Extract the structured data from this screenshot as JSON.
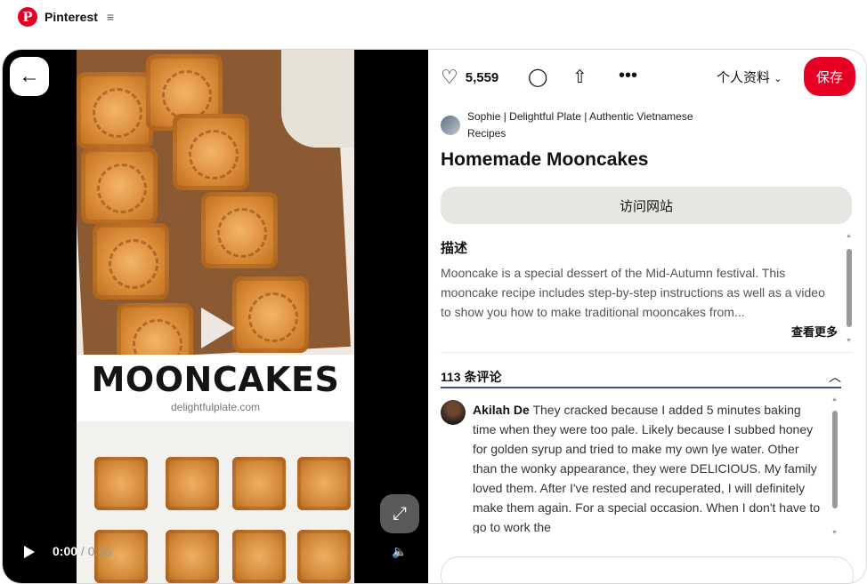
{
  "app": {
    "name": "Pinterest",
    "accent": "#e60023"
  },
  "media": {
    "banner_title": "MOONCAKES",
    "banner_sub": "delightfulplate.com",
    "time_current": "0:00",
    "time_total": "0:55",
    "progress": 0
  },
  "actions": {
    "like_count": "5,559",
    "profile_label": "个人资料",
    "save_label": "保存"
  },
  "pin": {
    "author": "Sophie | Delightful Plate | Authentic Vietnamese Recipes",
    "title": "Homemade Mooncakes",
    "visit_label": "访问网站",
    "desc_heading": "描述",
    "description": "Mooncake is a special dessert of the Mid-Autumn festival. This mooncake recipe includes step-by-step instructions as well as a video to show you how to make traditional mooncakes from...",
    "more_label": "查看更多"
  },
  "comments": {
    "heading": "113 条评论",
    "items": [
      {
        "author": "Akilah De",
        "text": "They cracked because I added 5 minutes baking time when they were too pale. Likely because I subbed honey for golden syrup and tried to make my own lye water. Other than the wonky appearance, they were DELICIOUS. My family loved them. After I've rested and recuperated, I will definitely make them again. For a special occasion. When I don't have to go to work the"
      }
    ]
  },
  "icons": [
    "pinterest-logo-icon",
    "menu-icon",
    "back-arrow-icon",
    "play-icon",
    "expand-icon",
    "volume-icon",
    "heart-icon",
    "comment-icon",
    "share-icon",
    "more-icon",
    "chevron-down-icon",
    "chevron-up-icon"
  ]
}
